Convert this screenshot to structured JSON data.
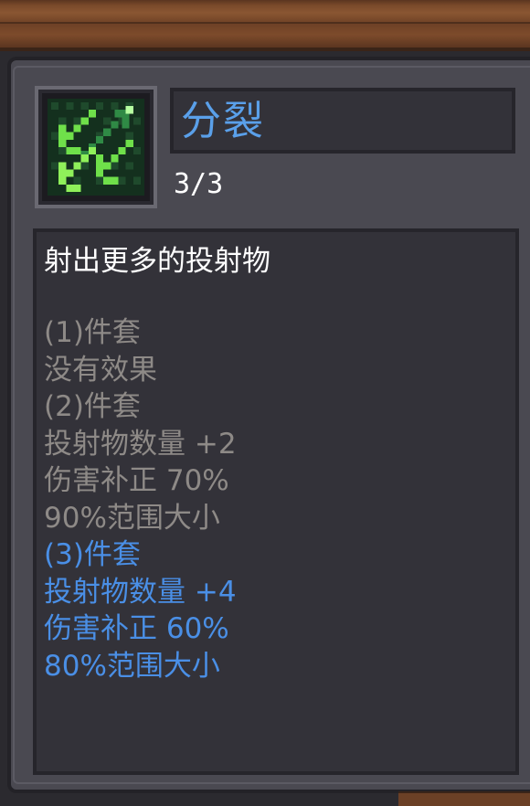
{
  "skill": {
    "name": "分裂",
    "level": "3/3",
    "icon": "split-arrows-icon",
    "description": "射出更多的投射物"
  },
  "set_bonuses": [
    {
      "text": "(1)件套",
      "active": false
    },
    {
      "text": "没有效果",
      "active": false
    },
    {
      "text": "(2)件套",
      "active": false
    },
    {
      "text": "投射物数量 +2",
      "active": false
    },
    {
      "text": "伤害补正 70%",
      "active": false
    },
    {
      "text": "90%范围大小",
      "active": false
    },
    {
      "text": "(3)件套",
      "active": true
    },
    {
      "text": "投射物数量 +4",
      "active": true
    },
    {
      "text": "伤害补正 60%",
      "active": true
    },
    {
      "text": "80%范围大小",
      "active": true
    }
  ],
  "colors": {
    "title": "#5aa0ea",
    "active_bonus": "#4a8fe6",
    "inactive_bonus": "#8e8a87",
    "icon_green": "#6fe04a"
  }
}
